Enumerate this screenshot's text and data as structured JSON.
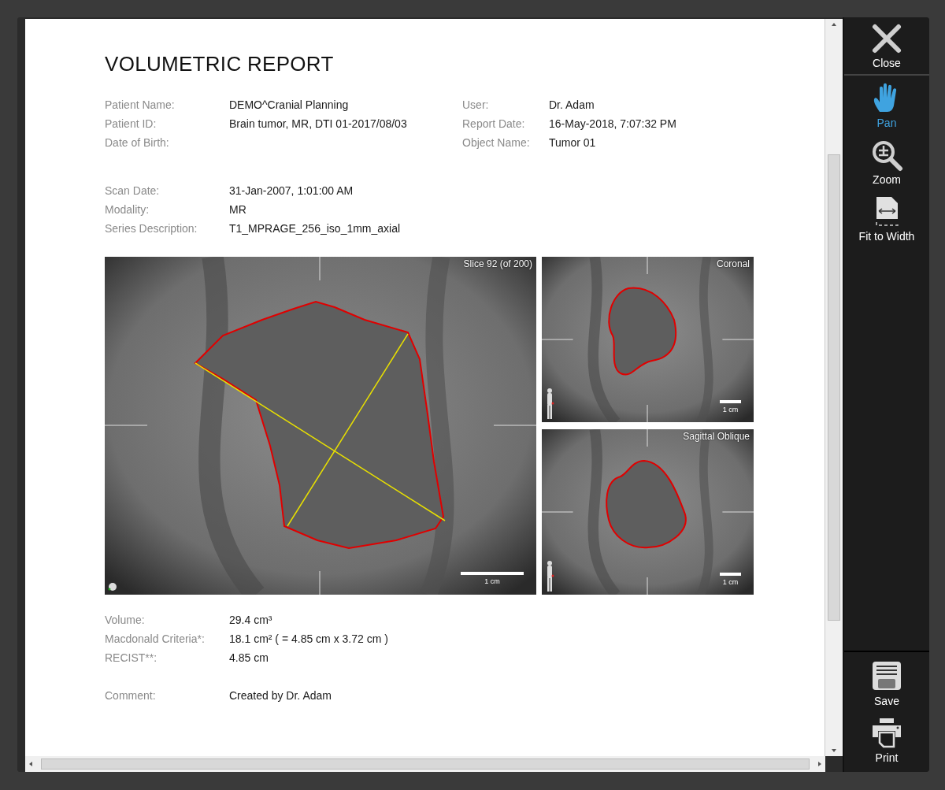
{
  "report": {
    "title": "VOLUMETRIC REPORT",
    "patient_fields": [
      {
        "label": "Patient Name:",
        "value": "DEMO^Cranial Planning"
      },
      {
        "label": "Patient ID:",
        "value": "Brain tumor, MR, DTI 01-2017/08/03"
      },
      {
        "label": "Date of Birth:"
      }
    ],
    "object_fields": [
      {
        "label": "User:",
        "value": "Dr. Adam"
      },
      {
        "label": "Report Date:",
        "value": "16-May-2018, 7:07:32 PM"
      },
      {
        "label": "Object Name:",
        "value": "Tumor 01"
      }
    ],
    "scan_fields": [
      {
        "label": "Scan Date:",
        "value": "31-Jan-2007, 1:01:00 AM"
      },
      {
        "label": "Modality:",
        "value": "MR"
      },
      {
        "label": "Series Description:",
        "value": "T1_MPRAGE_256_iso_1mm_axial"
      }
    ],
    "images": [
      {
        "kind": "axial",
        "caption": "Slice 92 (of 200)",
        "scale": "1 cm"
      },
      {
        "kind": "coronal",
        "caption": "Coronal",
        "scale": "1 cm"
      },
      {
        "kind": "sagittal",
        "caption": "Sagittal Oblique",
        "scale": "1 cm"
      }
    ],
    "measurements": [
      {
        "label": "Volume:",
        "value": "29.4 cm³"
      },
      {
        "label": "Macdonald Criteria*:",
        "value": "18.1 cm² ( = 4.85 cm x 3.72 cm )"
      },
      {
        "label": "RECIST**:",
        "value": "4.85 cm"
      }
    ],
    "comment": {
      "label": "Comment:",
      "value": "Created by Dr. Adam"
    }
  },
  "toolbar": {
    "top": [
      {
        "kind": "close",
        "label": "Close",
        "selected": false
      }
    ],
    "tools": [
      {
        "kind": "pan",
        "label": "Pan",
        "selected": true
      },
      {
        "kind": "zoom",
        "label": "Zoom",
        "selected": false
      },
      {
        "kind": "fit",
        "label": "Fit to Width",
        "selected": false
      }
    ],
    "bottom": [
      {
        "kind": "save",
        "label": "Save",
        "selected": false
      },
      {
        "kind": "print",
        "label": "Print",
        "selected": false
      }
    ]
  }
}
